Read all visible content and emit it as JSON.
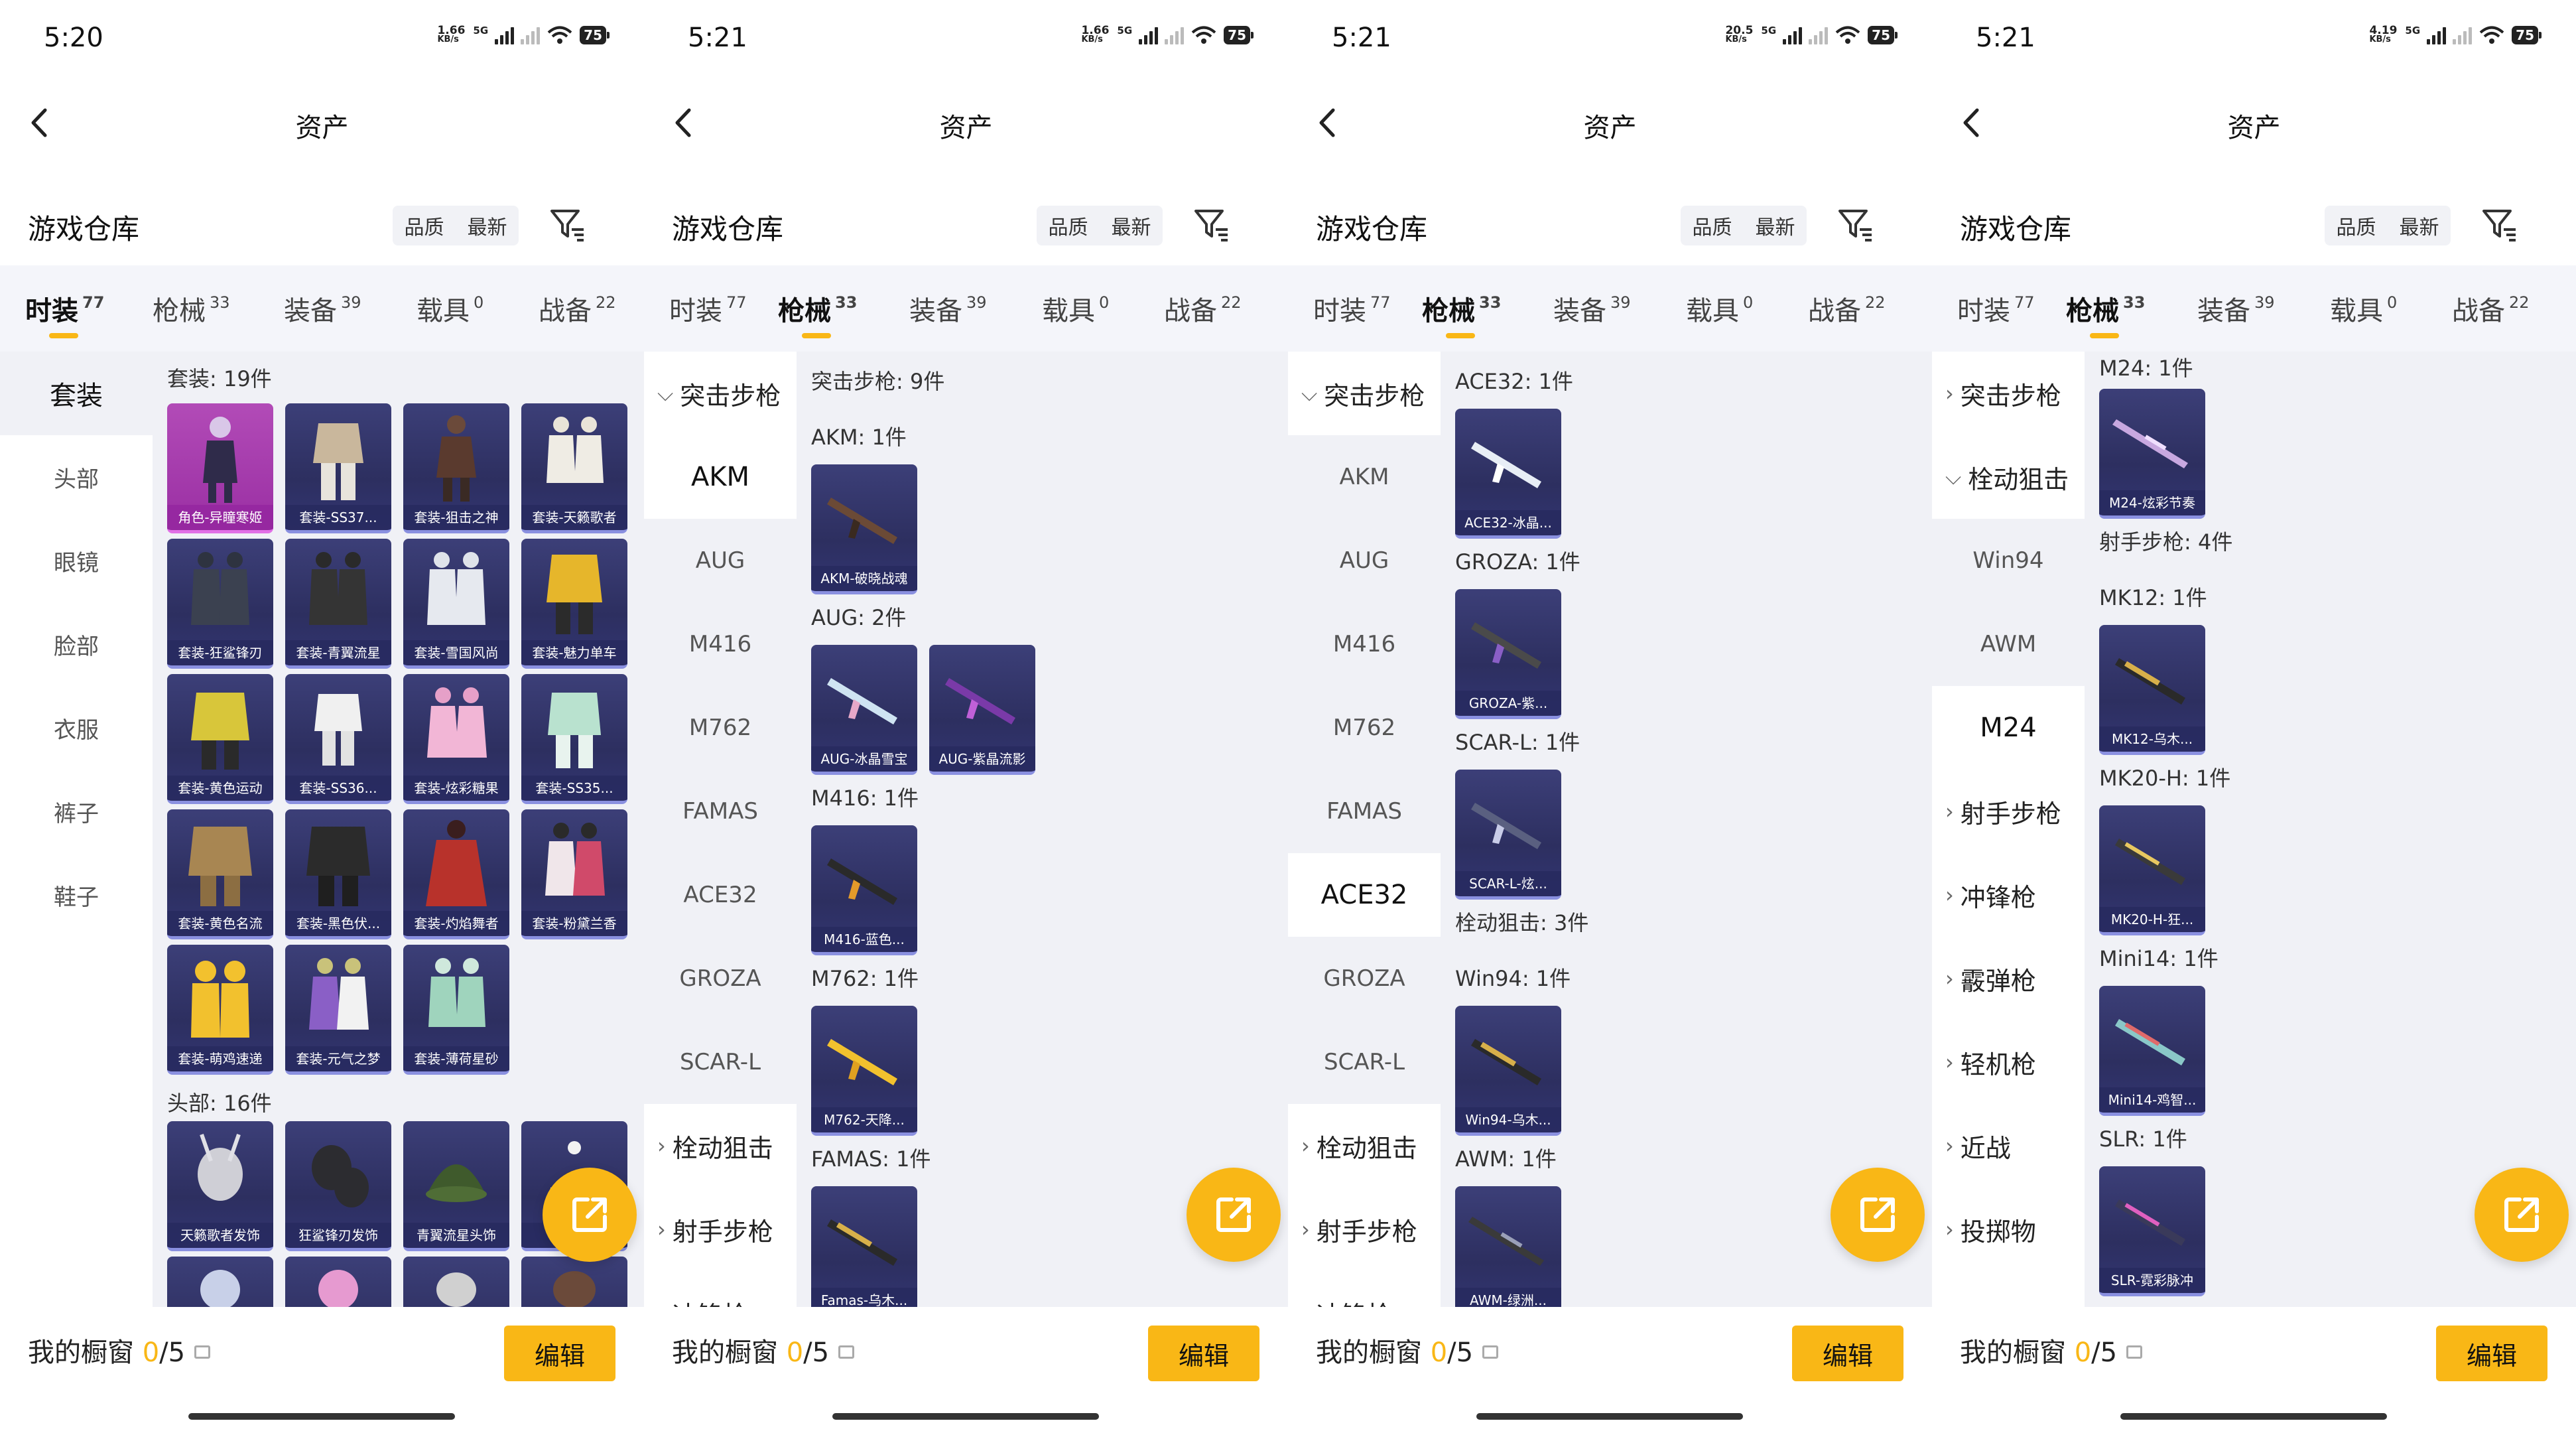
{
  "colors": {
    "accent": "#f9b716",
    "card_bg": "#3c3f78",
    "card_pink": "#b24bb7",
    "panel_bg": "#f0f1f6"
  },
  "common": {
    "title": "资产",
    "warehouse_title": "游戏仓库",
    "sort": [
      "品质",
      "最新"
    ],
    "categories": [
      {
        "label": "时装",
        "count": "77"
      },
      {
        "label": "枪械",
        "count": "33"
      },
      {
        "label": "装备",
        "count": "39"
      },
      {
        "label": "载具",
        "count": "0"
      },
      {
        "label": "战备",
        "count": "22"
      }
    ],
    "showcase_label": "我的橱窗",
    "showcase_current": "0",
    "showcase_total": "/5",
    "edit_label": "编辑"
  },
  "screens": [
    {
      "time": "5:20",
      "net_speed": "1.66",
      "active_category": 0,
      "sidebar": [
        "套装",
        "头部",
        "眼镜",
        "脸部",
        "衣服",
        "裤子",
        "鞋子"
      ],
      "sections": [
        {
          "title": "套装: 19件",
          "items": [
            "角色-异瞳寒姬",
            "套装-SS37...",
            "套装-狙击之神",
            "套装-天籁歌者",
            "套装-狂鲨锋刃",
            "套装-青翼流星",
            "套装-雪国风尚",
            "套装-魅力单车",
            "套装-黄色运动",
            "套装-SS36...",
            "套装-炫彩糖果",
            "套装-SS35...",
            "套装-黄色名流",
            "套装-黑色伏...",
            "套装-灼焰舞者",
            "套装-粉黛兰香",
            "套装-萌鸡速递",
            "套装-元气之梦",
            "套装-薄荷星砂"
          ]
        },
        {
          "title": "头部: 16件",
          "items": [
            "天籁歌者发饰",
            "狂鲨锋刃发饰",
            "青翼流星头饰",
            "",
            "",
            "",
            ""
          ]
        }
      ]
    },
    {
      "time": "5:21",
      "net_speed": "1.66",
      "active_category": 1,
      "sidebar_group": "突击步枪",
      "sidebar": [
        "AKM",
        "AUG",
        "M416",
        "M762",
        "FAMAS",
        "ACE32",
        "GROZA",
        "SCAR-L"
      ],
      "sidebar_extra": [
        "栓动狙击",
        "射手步枪",
        "冲锋枪"
      ],
      "sections": [
        {
          "title": "突击步枪: 9件"
        },
        {
          "title": "AKM: 1件",
          "items": [
            "AKM-破晓战魂"
          ]
        },
        {
          "title": "AUG: 2件",
          "items": [
            "AUG-冰晶雪宝",
            "AUG-紫晶流影"
          ]
        },
        {
          "title": "M416: 1件",
          "items": [
            "M416-蓝色..."
          ]
        },
        {
          "title": "M762: 1件",
          "items": [
            "M762-天降..."
          ]
        },
        {
          "title": "FAMAS: 1件",
          "items": [
            "Famas-乌木..."
          ]
        }
      ]
    },
    {
      "time": "5:21",
      "net_speed": "20.5",
      "active_category": 1,
      "sidebar_group": "突击步枪",
      "sidebar": [
        "AKM",
        "AUG",
        "M416",
        "M762",
        "FAMAS",
        "ACE32",
        "GROZA",
        "SCAR-L"
      ],
      "sidebar_extra": [
        "栓动狙击",
        "射手步枪",
        "冲锋枪"
      ],
      "sections": [
        {
          "title": "ACE32: 1件",
          "items": [
            "ACE32-冰晶..."
          ]
        },
        {
          "title": "GROZA: 1件",
          "items": [
            "GROZA-紫..."
          ]
        },
        {
          "title": "SCAR-L: 1件",
          "items": [
            "SCAR-L-炫..."
          ]
        },
        {
          "title": "栓动狙击: 3件"
        },
        {
          "title": "Win94: 1件",
          "items": [
            "Win94-乌木..."
          ]
        },
        {
          "title": "AWM: 1件",
          "items": [
            "AWM-绿洲..."
          ]
        }
      ]
    },
    {
      "time": "5:21",
      "net_speed": "4.19",
      "active_category": 1,
      "sidebar_top": "突击步枪",
      "sidebar_group": "栓动狙击",
      "sidebar": [
        "Win94",
        "AWM",
        "M24"
      ],
      "sidebar_extra": [
        "射手步枪",
        "冲锋枪",
        "霰弹枪",
        "轻机枪",
        "近战",
        "投掷物"
      ],
      "sections": [
        {
          "title": "M24: 1件",
          "items": [
            "M24-炫彩节奏"
          ]
        },
        {
          "title": "射手步枪: 4件"
        },
        {
          "title": "MK12: 1件",
          "items": [
            "MK12-乌木..."
          ]
        },
        {
          "title": "MK20-H: 1件",
          "items": [
            "MK20-H-狂..."
          ]
        },
        {
          "title": "Mini14: 1件",
          "items": [
            "Mini14-鸡智..."
          ]
        },
        {
          "title": "SLR: 1件",
          "items": [
            "SLR-霓彩脉冲"
          ]
        }
      ]
    }
  ]
}
